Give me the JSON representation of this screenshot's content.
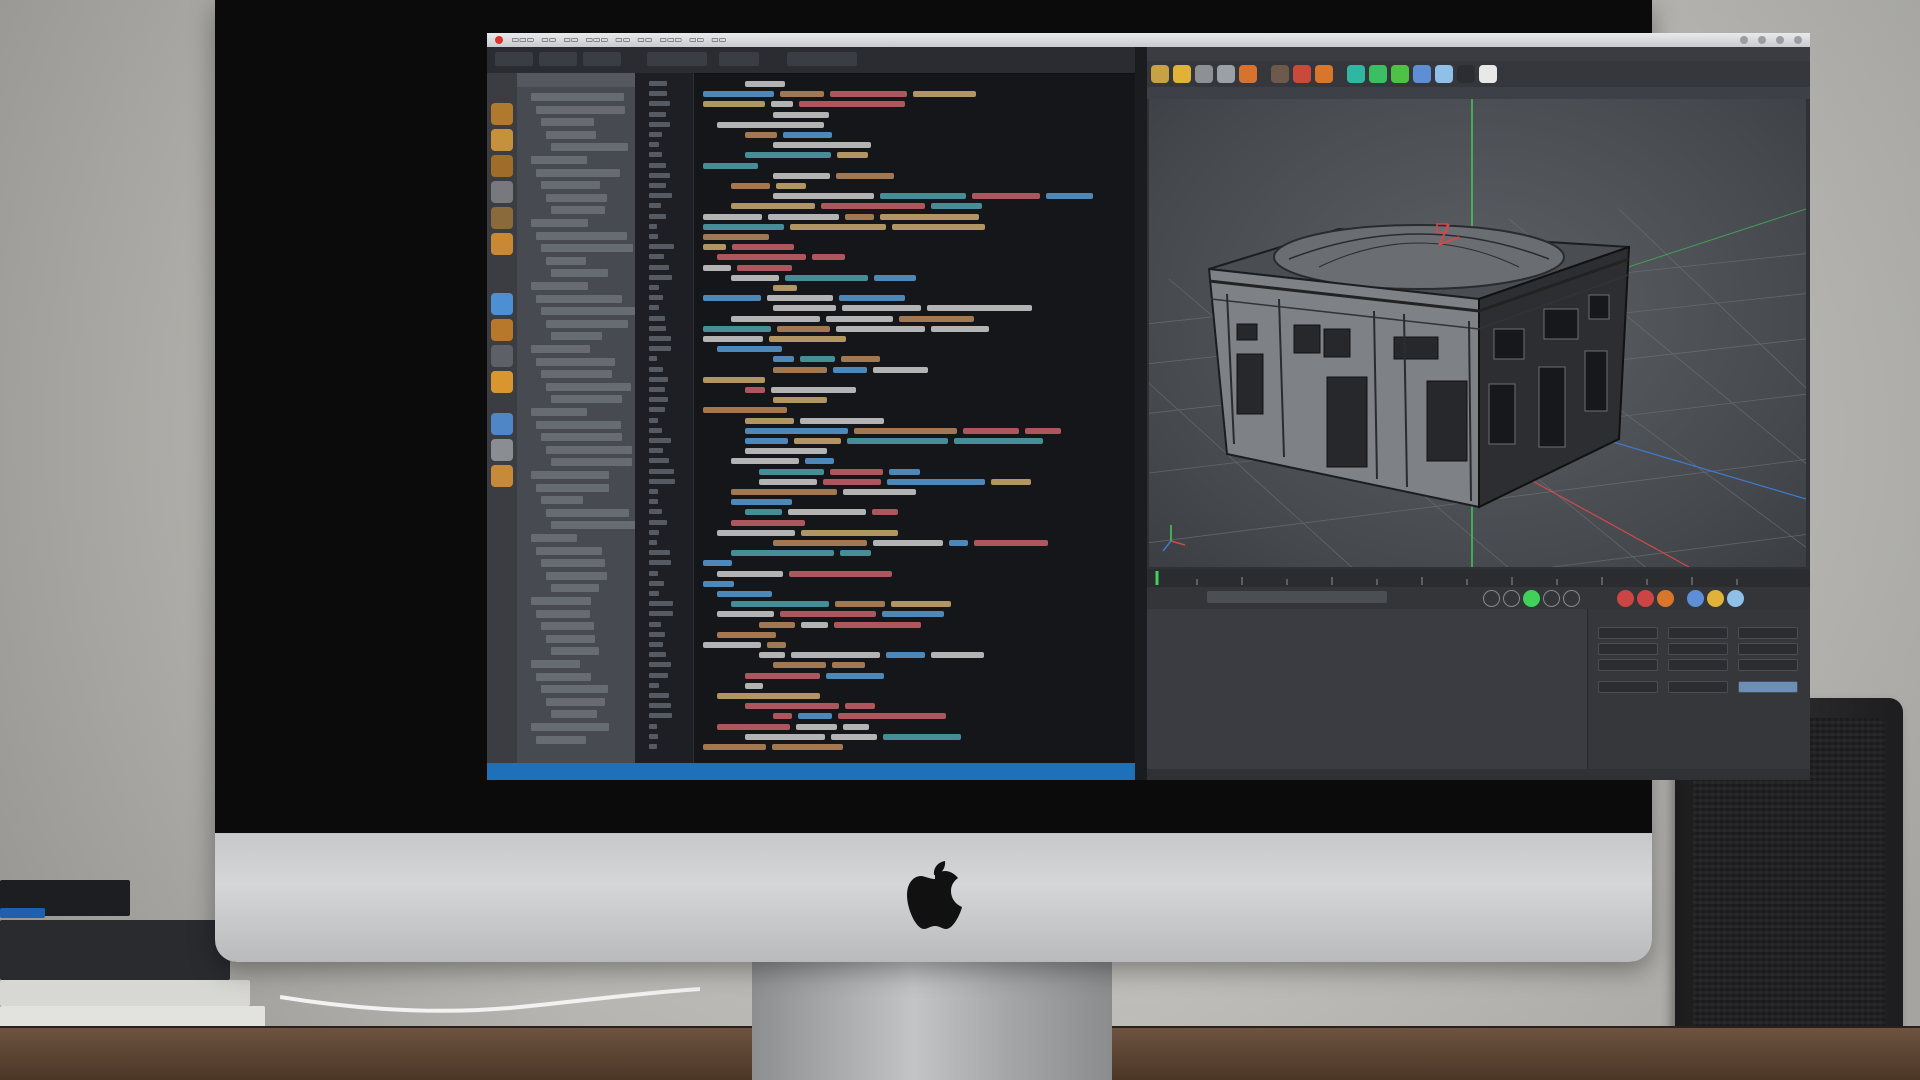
{
  "scene": {
    "description_free": true,
    "colors": {
      "code_keyword": "#e06c75",
      "code_string": "#e5c07b",
      "code_function": "#61afef",
      "code_variable": "#e8e8e8",
      "code_comment": "#56b6c2",
      "code_orange": "#d19a66",
      "status_bar": "#1e70b8",
      "axis_green": "#3fd15a",
      "axis_red": "#d14a4a",
      "axis_blue": "#3f7bd1"
    }
  },
  "icons": {
    "apple": "apple-logo-icon",
    "speaker": "speaker-grille"
  }
}
